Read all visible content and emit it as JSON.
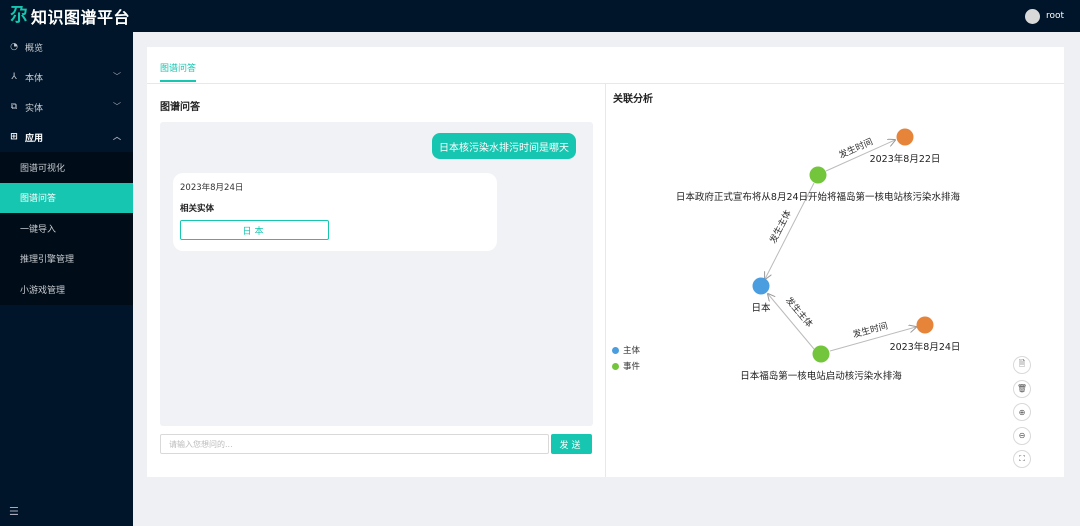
{
  "app": {
    "logo_mark": "尕",
    "title": "知识图谱平台"
  },
  "user": {
    "name": "root"
  },
  "sidebar": {
    "items": [
      {
        "label": "概览",
        "icon": "dashboard-icon"
      },
      {
        "label": "本体",
        "icon": "ontology-icon"
      },
      {
        "label": "实体",
        "icon": "entity-icon"
      },
      {
        "label": "应用",
        "icon": "apps-icon"
      }
    ],
    "sub_items": [
      "图谱可视化",
      "图谱问答",
      "一键导入",
      "推理引擎管理",
      "小游戏管理"
    ],
    "active_sub": "图谱问答"
  },
  "tabs": {
    "active": "图谱问答"
  },
  "qa": {
    "title": "图谱问答",
    "question": "日本核污染水排污时间是哪天",
    "answer_date": "2023年8月24日",
    "answer_subtitle": "相关实体",
    "entity_button": "日本",
    "input_placeholder": "请输入您想问的...",
    "send_label": "发送"
  },
  "graph": {
    "title": "关联分析",
    "nodes": [
      {
        "id": "n1",
        "label": "2023年8月22日",
        "type": "date",
        "color": "#e6843a"
      },
      {
        "id": "n2",
        "label": "日本政府正式宣布将从8月24日开始将福岛第一核电站核污染水排海",
        "type": "event",
        "color": "#73c53b"
      },
      {
        "id": "n3",
        "label": "日本",
        "type": "subject",
        "color": "#4a9ee0"
      },
      {
        "id": "n4",
        "label": "日本福岛第一核电站启动核污染水排海",
        "type": "event",
        "color": "#73c53b"
      },
      {
        "id": "n5",
        "label": "2023年8月24日",
        "type": "date",
        "color": "#e6843a"
      }
    ],
    "edges": [
      {
        "from": "n2",
        "to": "n1",
        "label": "发生时间"
      },
      {
        "from": "n2",
        "to": "n3",
        "label": "发生主体"
      },
      {
        "from": "n4",
        "to": "n3",
        "label": "发生主体"
      },
      {
        "from": "n4",
        "to": "n5",
        "label": "发生时间"
      }
    ],
    "legend": [
      {
        "label": "主体",
        "color": "#4a9ee0"
      },
      {
        "label": "事件",
        "color": "#73c53b"
      }
    ],
    "tools": [
      "export-icon",
      "delete-icon",
      "zoom-in-icon",
      "zoom-out-icon",
      "fit-screen-icon"
    ]
  },
  "colors": {
    "accent": "#17c6b0",
    "nav_bg": "#001529"
  }
}
